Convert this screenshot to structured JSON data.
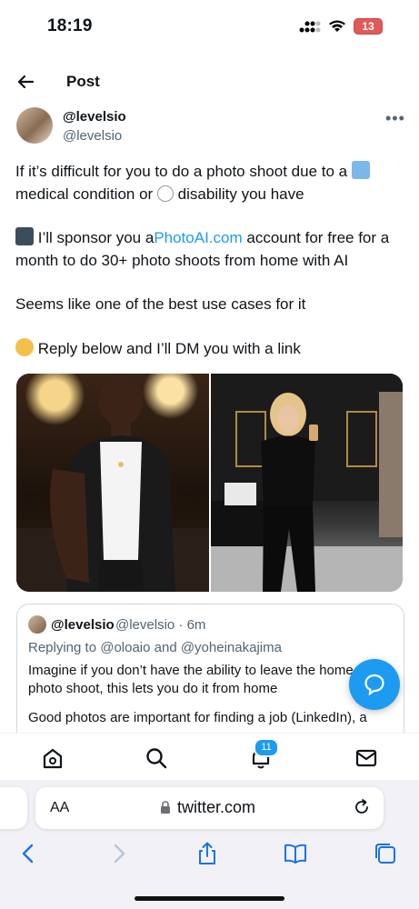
{
  "status": {
    "time": "18:19",
    "battery": "13"
  },
  "header": {
    "title": "Post"
  },
  "tweet": {
    "name": "@levelsio",
    "handle": "@levelsio",
    "line1a": "If it’s difficult for you to do a photo shoot due to a",
    "line1b": "medical condition or",
    "line1c": "disability you have",
    "line2a": "I’ll sponsor you a",
    "link": "PhotoAI.com",
    "line2b": " account for free for a month to do 30+ photo shoots from home with AI",
    "line3": "Seems like one of the best use cases for it",
    "line4": "Reply below and I’ll DM you with a link"
  },
  "quote": {
    "name": "@levelsio",
    "handle": "@levelsio · 6m",
    "reply": "Replying to @oloaio and @yoheinakajima",
    "text1": "Imagine if you don’t have the ability to leave the home for a photo shoot, this lets you do it from home",
    "text2": "Good photos are important for finding a job (LinkedIn), a"
  },
  "tabbar": {
    "notification_count": "11"
  },
  "safari": {
    "aa_label": "AA",
    "url": "twitter.com"
  },
  "colors": {
    "accent": "#1d9bf0",
    "text": "#0f1419",
    "muted": "#536471"
  },
  "icons": [
    "back-arrow-icon",
    "more-icon",
    "home-icon",
    "search-icon",
    "bell-icon",
    "mail-icon",
    "compose-icon",
    "lock-icon",
    "reload-icon",
    "chevron-left-icon",
    "chevron-right-icon",
    "share-icon",
    "bookmarks-icon",
    "tabs-icon"
  ]
}
